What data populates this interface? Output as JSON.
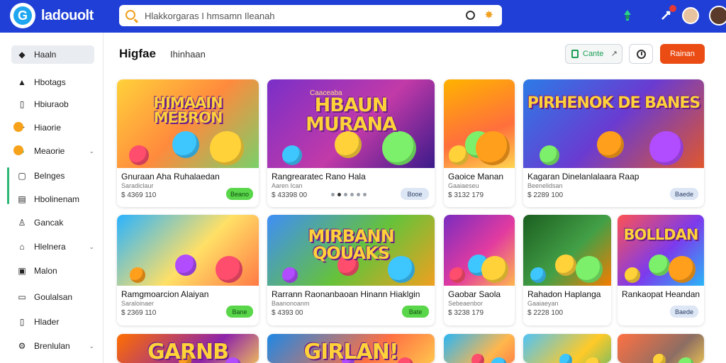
{
  "app": {
    "logo_text": "ladouolt",
    "logo_letter": "G"
  },
  "search": {
    "placeholder": "Hlakkorgaras I hmsamn Ileanah"
  },
  "header": {
    "title": "Higfae",
    "subtitle": "Ihinhaan"
  },
  "actions": {
    "game_label": "Cante",
    "primary_label": "Rainan"
  },
  "sidebar": {
    "items": [
      {
        "label": "Haaln",
        "icon": "gamepad-icon",
        "active": true
      },
      {
        "label": "Hbotags",
        "icon": "tag-icon"
      },
      {
        "label": "Hbiuraob",
        "icon": "bookmark-icon"
      },
      {
        "label": "Hiaorie",
        "icon": "star-icon",
        "badge": true
      },
      {
        "label": "Meaorie",
        "icon": "circle-icon",
        "badge": true,
        "chevron": true
      },
      {
        "label": "Belnges",
        "icon": "grid-icon"
      },
      {
        "label": "Hbolinenam",
        "icon": "list-icon"
      },
      {
        "label": "Gancak",
        "icon": "person-icon"
      },
      {
        "label": "Hlelnera",
        "icon": "home-icon",
        "chevron": true
      },
      {
        "label": "Malon",
        "icon": "box-icon"
      },
      {
        "label": "Goulalsan",
        "icon": "folder-icon"
      },
      {
        "label": "Hlader",
        "icon": "file-icon"
      },
      {
        "label": "Brenlulan",
        "icon": "settings-icon",
        "chevron": true
      }
    ]
  },
  "colors": {
    "brand": "#1f3fd6",
    "accent": "#ea4c14",
    "green": "#5ad64a"
  },
  "cards": [
    {
      "thumb_title": "HIMAAIN MEBRON",
      "title": "Gnuraan Aha Ruhalaedan",
      "sub": "Saradiclaur",
      "price": "$ 4369 110",
      "pill": "Beano",
      "pill_style": "green",
      "thumb_bg": "linear-gradient(135deg,#ffd13a,#ff8a3d 50%,#7ad06a)"
    },
    {
      "thumb_title": "HBAUN MURANA",
      "thumb_caption": "Caaceaba",
      "title": "Rangrearatec Rano Hala",
      "sub": "Aaren Ican",
      "price": "$ 43398 00",
      "pill": "Booe",
      "pill_style": "blue",
      "dots": true,
      "thumb_bg": "linear-gradient(135deg,#7a2fc8,#c23aa8 55%,#3b1a8a)"
    },
    {
      "thumb_title": "",
      "title": "Gaoice Manan",
      "sub": "Gaaiaeseu",
      "price": "$ 3132 179",
      "pill": "",
      "pill_style": "",
      "thumb_bg": "linear-gradient(160deg,#ffb300,#ff6f3c 60%,#ffd54f)"
    },
    {
      "thumb_title": "PIRHENOK DE BANES",
      "title": "Kagaran Dinelanlalaara Raap",
      "sub": "Beenelidsan",
      "price": "$ 2289 100",
      "pill": "Baede",
      "pill_style": "blue",
      "thumb_bg": "linear-gradient(135deg,#2c7be5,#6a3bd1 50%,#e0572c)"
    },
    {
      "thumb_title": "",
      "title": "Ramgmoarcion Alaiyan",
      "sub": "Saraloinaer",
      "price": "$ 2369 110",
      "pill": "Bane",
      "pill_style": "green",
      "thumb_bg": "linear-gradient(135deg,#2ab3ff,#ffe066 55%,#ff7a45)"
    },
    {
      "thumb_title": "MIRBANN QOUAKS",
      "title": "Rarrann Raonanbaoan Hinann Hiaklgin",
      "sub": "Baanonoanm",
      "price": "$ 4393 00",
      "pill": "Bate",
      "pill_style": "green",
      "thumb_bg": "linear-gradient(135deg,#3e8ef7,#66c23a 55%,#f0a020)"
    },
    {
      "thumb_title": "",
      "title": "Gaobar Saola",
      "sub": "Sebeaenbor",
      "price": "$ 3238 179",
      "pill": "",
      "pill_style": "",
      "thumb_bg": "linear-gradient(135deg,#7a2cc0,#e23ba0 55%,#ffb74d)"
    },
    {
      "thumb_title": "",
      "title": "Rahadon Haplanga",
      "sub": "Gaaiaeyan",
      "price": "$ 2228 100",
      "pill": "",
      "pill_style": "",
      "thumb_bg": "linear-gradient(135deg,#1b5e20,#43a047 55%,#f57c00)"
    },
    {
      "thumb_title": "BOLLDAN",
      "title": "Rankaopat Heandan",
      "sub": "",
      "price": "",
      "pill": "Baede",
      "pill_style": "blue",
      "thumb_bg": "linear-gradient(135deg,#ff5252,#7c3aed 55%,#29b6f6)"
    },
    {
      "thumb_title": "GARNB",
      "title": "",
      "sub": "",
      "price": "",
      "pill": "",
      "pill_style": "",
      "thumb_bg": "linear-gradient(135deg,#ff6f00,#8e24aa 60%,#ffd54f)"
    },
    {
      "thumb_title": "GIRLAN!",
      "title": "",
      "sub": "",
      "price": "",
      "pill": "",
      "pill_style": "",
      "thumb_bg": "linear-gradient(135deg,#1e88e5,#ff7043 60%,#ffd54f)"
    },
    {
      "thumb_title": "",
      "title": "",
      "sub": "",
      "price": "",
      "pill": "",
      "pill_style": "",
      "thumb_bg": "linear-gradient(135deg,#29b6f6,#ffb74d 60%,#ff7043)"
    },
    {
      "thumb_title": "",
      "title": "",
      "sub": "",
      "price": "",
      "pill": "",
      "pill_style": "",
      "thumb_bg": "linear-gradient(135deg,#4fc3f7,#ffca28 60%,#66bb6a)"
    },
    {
      "thumb_title": "",
      "title": "",
      "sub": "",
      "price": "",
      "pill": "",
      "pill_style": "",
      "thumb_bg": "linear-gradient(135deg,#ff7043,#8d6e63 60%,#ffd54f)"
    }
  ]
}
